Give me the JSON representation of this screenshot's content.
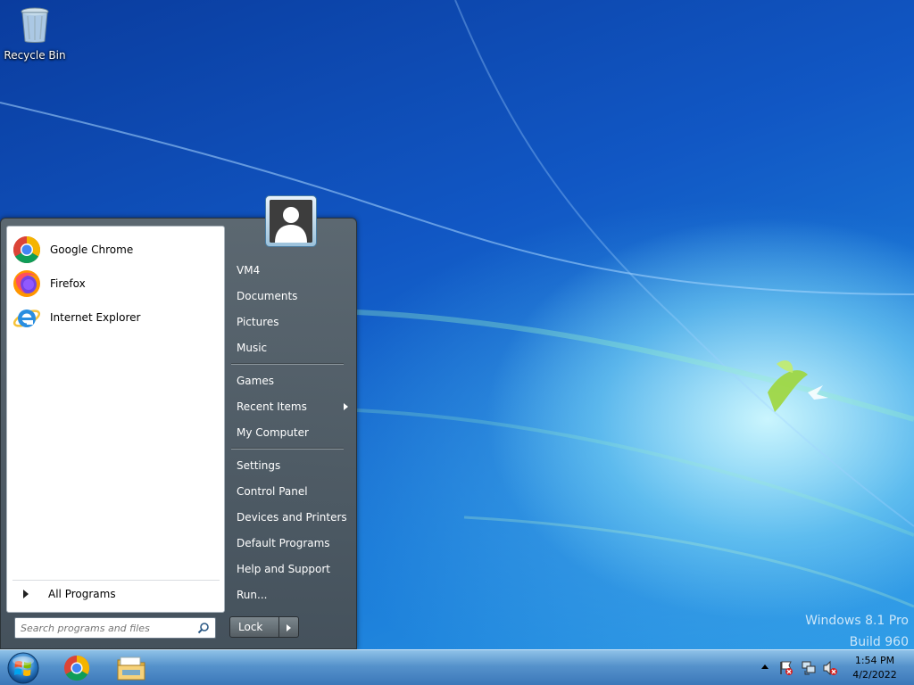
{
  "desktop": {
    "icons": [
      {
        "label": "Recycle Bin",
        "icon": "recycle-bin-icon"
      }
    ],
    "watermark": {
      "line1": "Windows 8.1 Pro",
      "line2": "Build 960"
    }
  },
  "start_menu": {
    "pinned": [
      {
        "label": "Google Chrome",
        "icon": "chrome-icon"
      },
      {
        "label": "Firefox",
        "icon": "firefox-icon"
      },
      {
        "label": "Internet Explorer",
        "icon": "internet-explorer-icon"
      }
    ],
    "all_programs": "All Programs",
    "search": {
      "placeholder": "Search programs and files",
      "value": ""
    },
    "user_picture": "user-avatar-icon",
    "right_items": [
      {
        "label": "VM4"
      },
      {
        "label": "Documents"
      },
      {
        "label": "Pictures"
      },
      {
        "label": "Music"
      },
      {
        "label": "Games"
      },
      {
        "label": "Recent Items",
        "has_submenu": true
      },
      {
        "label": "My Computer"
      },
      {
        "label": "Settings"
      },
      {
        "label": "Control Panel"
      },
      {
        "label": "Devices and Printers"
      },
      {
        "label": "Default Programs"
      },
      {
        "label": "Help and Support"
      },
      {
        "label": "Run..."
      }
    ],
    "lock_label": "Lock"
  },
  "taskbar": {
    "apps": [
      {
        "name": "Google Chrome",
        "icon": "chrome-icon"
      },
      {
        "name": "Windows Explorer",
        "icon": "folder-icon"
      }
    ],
    "tray_icons": [
      "action-center-flag-icon",
      "network-icon",
      "volume-muted-icon"
    ],
    "clock": {
      "time": "1:54 PM",
      "date": "4/2/2022"
    }
  },
  "colors": {
    "accent": "#1a7ad8",
    "menu_dark": "#5f696e",
    "taskbar": "#5a96cd"
  }
}
